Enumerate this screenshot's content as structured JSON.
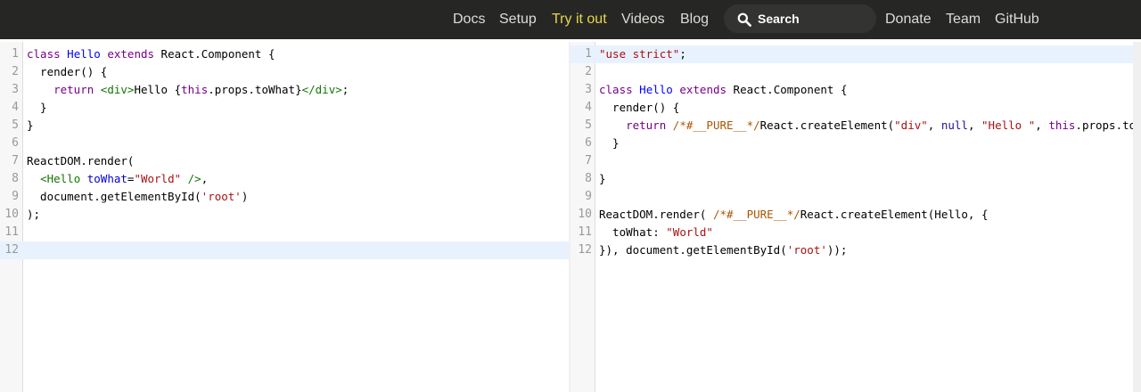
{
  "nav": {
    "items": [
      "Docs",
      "Setup",
      "Try it out",
      "Videos",
      "Blog"
    ],
    "search_placeholder": "Search",
    "items_right": [
      "Donate",
      "Team",
      "GitHub"
    ]
  },
  "editor": {
    "line_numbers": [
      "1",
      "2",
      "3",
      "4",
      "5",
      "6",
      "7",
      "8",
      "9",
      "10",
      "11",
      "12"
    ],
    "input_lines": [
      [
        [
          "kw",
          "class"
        ],
        [
          "t",
          " "
        ],
        [
          "def",
          "Hello"
        ],
        [
          "t",
          " "
        ],
        [
          "kw",
          "extends"
        ],
        [
          "t",
          " React.Component {"
        ]
      ],
      [
        [
          "t",
          "  render() {"
        ]
      ],
      [
        [
          "t",
          "    "
        ],
        [
          "kw",
          "return"
        ],
        [
          "t",
          " "
        ],
        [
          "tag",
          "<div>"
        ],
        [
          "t",
          "Hello {"
        ],
        [
          "kw",
          "this"
        ],
        [
          "t",
          ".props.toWhat}"
        ],
        [
          "tag",
          "</div>"
        ],
        [
          "t",
          ";"
        ]
      ],
      [
        [
          "t",
          "  }"
        ]
      ],
      [
        [
          "t",
          "}"
        ]
      ],
      [],
      [
        [
          "t",
          "ReactDOM.render("
        ]
      ],
      [
        [
          "t",
          "  "
        ],
        [
          "tag",
          "<Hello"
        ],
        [
          "t",
          " "
        ],
        [
          "attr",
          "toWhat"
        ],
        [
          "t",
          "="
        ],
        [
          "str",
          "\"World\""
        ],
        [
          "t",
          " "
        ],
        [
          "tag",
          "/>"
        ],
        [
          "t",
          ","
        ]
      ],
      [
        [
          "t",
          "  document.getElementById("
        ],
        [
          "str",
          "'root'"
        ],
        [
          "t",
          ")"
        ]
      ],
      [
        [
          "t",
          ");"
        ]
      ],
      [],
      []
    ],
    "output_lines": [
      [
        [
          "str",
          "\"use strict\""
        ],
        [
          "t",
          ";"
        ]
      ],
      [],
      [
        [
          "kw",
          "class"
        ],
        [
          "t",
          " "
        ],
        [
          "def",
          "Hello"
        ],
        [
          "t",
          " "
        ],
        [
          "kw",
          "extends"
        ],
        [
          "t",
          " React.Component {"
        ]
      ],
      [
        [
          "t",
          "  render() {"
        ]
      ],
      [
        [
          "t",
          "    "
        ],
        [
          "kw",
          "return"
        ],
        [
          "t",
          " "
        ],
        [
          "com",
          "/*#__PURE__*/"
        ],
        [
          "t",
          "React.createElement("
        ],
        [
          "str",
          "\"div\""
        ],
        [
          "t",
          ", "
        ],
        [
          "atom",
          "null"
        ],
        [
          "t",
          ", "
        ],
        [
          "str",
          "\"Hello \""
        ],
        [
          "t",
          ", "
        ],
        [
          "kw",
          "this"
        ],
        [
          "t",
          ".props.toWhat);"
        ]
      ],
      [
        [
          "t",
          "  }"
        ]
      ],
      [],
      [
        [
          "t",
          "}"
        ]
      ],
      [],
      [
        [
          "t",
          "ReactDOM.render( "
        ],
        [
          "com",
          "/*#__PURE__*/"
        ],
        [
          "t",
          "React.createElement(Hello, {"
        ]
      ],
      [
        [
          "t",
          "  toWhat: "
        ],
        [
          "str",
          "\"World\""
        ]
      ],
      [
        [
          "t",
          "}), document.getElementById("
        ],
        [
          "str",
          "'root'"
        ],
        [
          "t",
          "));"
        ]
      ]
    ]
  }
}
